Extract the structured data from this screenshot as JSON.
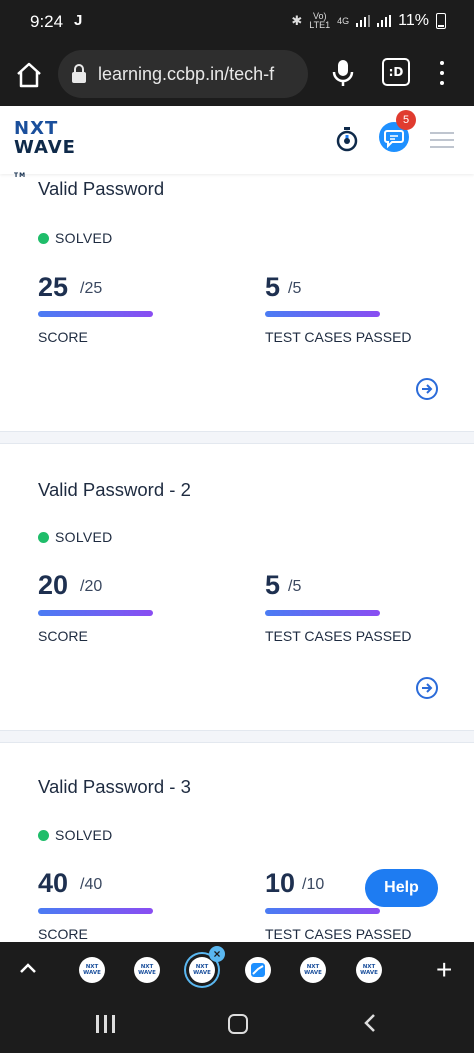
{
  "status_bar": {
    "time": "9:24",
    "notification_glyph": "J",
    "network_top": "Vo)",
    "network_bottom": "LTE1",
    "network_type": "4G",
    "battery": "11%"
  },
  "browser": {
    "url": "learning.ccbp.in/tech-f",
    "tab_count_label": ":D"
  },
  "app_header": {
    "logo_top": "NXT",
    "logo_bottom": "WAVE",
    "logo_tm": "TM",
    "notification_count": "5"
  },
  "cards": [
    {
      "title": "Valid Password",
      "status": "SOLVED",
      "score": "25",
      "score_total": "/25",
      "score_label": "SCORE",
      "tests": "5",
      "tests_total": "/5",
      "tests_label": "TEST CASES PASSED"
    },
    {
      "title": "Valid Password - 2",
      "status": "SOLVED",
      "score": "20",
      "score_total": "/20",
      "score_label": "SCORE",
      "tests": "5",
      "tests_total": "/5",
      "tests_label": "TEST CASES PASSED"
    },
    {
      "title": "Valid Password - 3",
      "status": "SOLVED",
      "score": "40",
      "score_total": "/40",
      "score_label": "SCORE",
      "tests": "10",
      "tests_total": "/10",
      "tests_label": "TEST CASES PASSED"
    }
  ],
  "help_button": "Help",
  "tab_strip": {
    "thumb_label_top": "NXT",
    "thumb_label_bottom": "WAVE",
    "close_glyph": "×",
    "plus_glyph": "+"
  },
  "colors": {
    "accent": "#1e7cf2",
    "solved_green": "#1fbd6a",
    "badge_red": "#e03b2f",
    "progress_start": "#4a7cf3",
    "progress_end": "#8a4df2"
  }
}
